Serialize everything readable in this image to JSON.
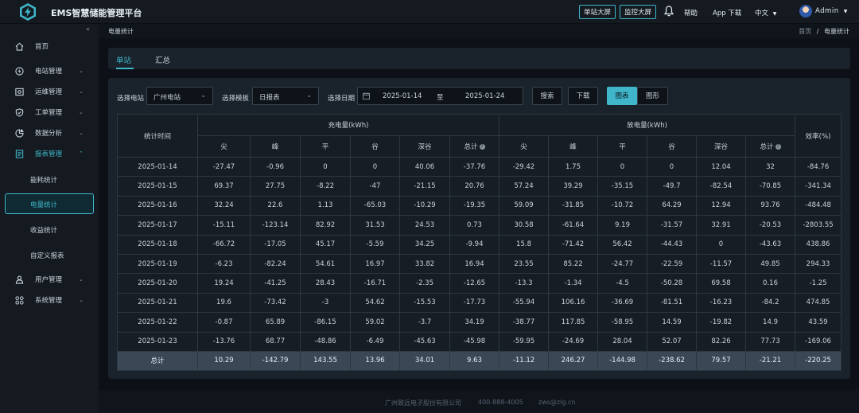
{
  "app": {
    "title": "EMS智慧储能管理平台"
  },
  "header": {
    "btn_single_screen": "单站大屏",
    "btn_monitor_screen": "监控大屏",
    "help": "帮助",
    "app_download": "App 下载",
    "language": "中文",
    "language_caret": "▼",
    "user_name": "Admin",
    "user_caret": "▼"
  },
  "sidebar": {
    "collapse_glyph": "«",
    "items": [
      {
        "label": "首页",
        "icon": "home-icon",
        "chevron": ""
      },
      {
        "label": "电站管理",
        "icon": "power-station-icon",
        "chevron": "⌄"
      },
      {
        "label": "运维管理",
        "icon": "maintenance-icon",
        "chevron": "⌄"
      },
      {
        "label": "工单管理",
        "icon": "work-order-icon",
        "chevron": "⌄"
      },
      {
        "label": "数据分析",
        "icon": "chart-icon",
        "chevron": "⌄"
      },
      {
        "label": "报表管理",
        "icon": "report-icon",
        "chevron": "⌃"
      },
      {
        "label": "用户管理",
        "icon": "user-icon",
        "chevron": "⌄"
      },
      {
        "label": "系统管理",
        "icon": "system-icon",
        "chevron": "⌄"
      }
    ],
    "report_sub": [
      "能耗统计",
      "电量统计",
      "收益统计",
      "自定义报表"
    ]
  },
  "breadcrumb": {
    "current": "电量统计",
    "home": "首页",
    "sep": "/",
    "page": "电量统计"
  },
  "tabs": [
    "单站",
    "汇总"
  ],
  "filters": {
    "station_label": "选择电站",
    "station_value": "广州电站",
    "template_label": "选择模板",
    "template_value": "日报表",
    "date_label": "选择日期",
    "date_start": "2025-01-14",
    "date_to": "至",
    "date_end": "2025-01-24",
    "search": "搜索",
    "download": "下载",
    "view_table": "图表",
    "view_chart": "图形",
    "caret": "⌄"
  },
  "table": {
    "col_time": "统计时间",
    "charge_group": "充电量(kWh)",
    "discharge_group": "放电量(kWh)",
    "efficiency": "效率(%)",
    "sub_headers": [
      "尖",
      "峰",
      "平",
      "谷",
      "深谷",
      "总计"
    ],
    "tip_glyph": "?",
    "rows": [
      [
        "2025-01-14",
        "-27.47",
        "-0.96",
        "0",
        "0",
        "40.06",
        "-37.76",
        "-29.42",
        "1.75",
        "0",
        "0",
        "12.04",
        "32",
        "-84.76"
      ],
      [
        "2025-01-15",
        "69.37",
        "27.75",
        "-8.22",
        "-47",
        "-21.15",
        "20.76",
        "57.24",
        "39.29",
        "-35.15",
        "-49.7",
        "-82.54",
        "-70.85",
        "-341.34"
      ],
      [
        "2025-01-16",
        "32.24",
        "22.6",
        "1.13",
        "-65.03",
        "-10.29",
        "-19.35",
        "59.09",
        "-31.85",
        "-10.72",
        "64.29",
        "12.94",
        "93.76",
        "-484.48"
      ],
      [
        "2025-01-17",
        "-15.11",
        "-123.14",
        "82.92",
        "31.53",
        "24.53",
        "0.73",
        "30.58",
        "-61.64",
        "9.19",
        "-31.57",
        "32.91",
        "-20.53",
        "-2803.55"
      ],
      [
        "2025-01-18",
        "-66.72",
        "-17.05",
        "45.17",
        "-5.59",
        "34.25",
        "-9.94",
        "15.8",
        "-71.42",
        "56.42",
        "-44.43",
        "0",
        "-43.63",
        "438.86"
      ],
      [
        "2025-01-19",
        "-6.23",
        "-82.24",
        "54.61",
        "16.97",
        "33.82",
        "16.94",
        "23.55",
        "85.22",
        "-24.77",
        "-22.59",
        "-11.57",
        "49.85",
        "294.33"
      ],
      [
        "2025-01-20",
        "19.24",
        "-41.25",
        "28.43",
        "-16.71",
        "-2.35",
        "-12.65",
        "-13.3",
        "-1.34",
        "-4.5",
        "-50.28",
        "69.58",
        "0.16",
        "-1.25"
      ],
      [
        "2025-01-21",
        "19.6",
        "-73.42",
        "-3",
        "54.62",
        "-15.53",
        "-17.73",
        "-55.94",
        "106.16",
        "-36.69",
        "-81.51",
        "-16.23",
        "-84.2",
        "474.85"
      ],
      [
        "2025-01-22",
        "-0.87",
        "65.89",
        "-86.15",
        "59.02",
        "-3.7",
        "34.19",
        "-38.77",
        "117.85",
        "-58.95",
        "14.59",
        "-19.82",
        "14.9",
        "43.59"
      ],
      [
        "2025-01-23",
        "-13.76",
        "68.77",
        "-48.86",
        "-6.49",
        "-45.63",
        "-45.98",
        "-59.95",
        "-24.69",
        "28.04",
        "52.07",
        "82.26",
        "77.73",
        "-169.06"
      ]
    ],
    "total": [
      "总计",
      "10.29",
      "-142.79",
      "143.55",
      "13.96",
      "34.01",
      "9.63",
      "-11.12",
      "246.27",
      "-144.98",
      "-238.62",
      "79.57",
      "-21.21",
      "-220.25"
    ]
  },
  "footer": {
    "company": "广州致远电子股份有限公司",
    "phone": "400-888-4005",
    "email": "zws@zlg.cn"
  },
  "colors": {
    "accent": "#3fb6c9",
    "background": "#0d1117",
    "card": "#1a222b"
  }
}
